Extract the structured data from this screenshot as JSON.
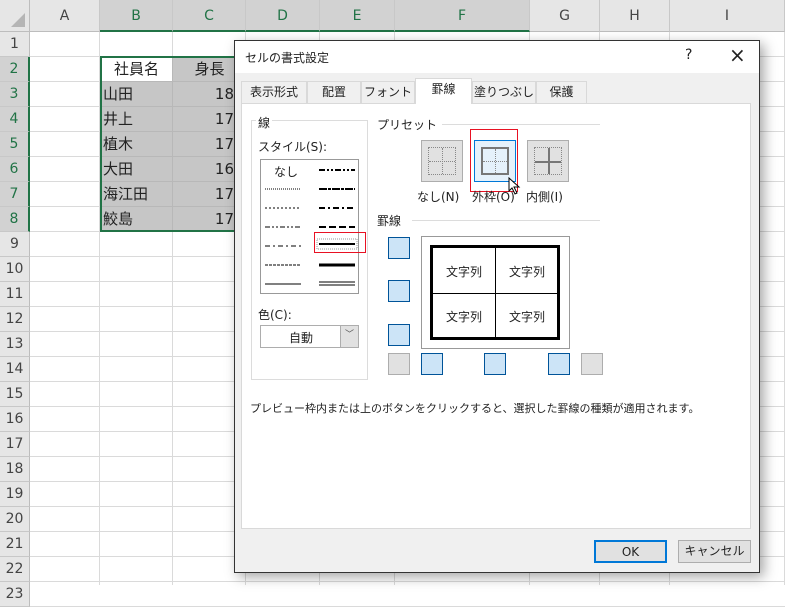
{
  "sheet": {
    "columns": [
      "A",
      "B",
      "C",
      "D",
      "E",
      "F",
      "G",
      "H",
      "I"
    ],
    "rows": [
      "1",
      "2",
      "3",
      "4",
      "5",
      "6",
      "7",
      "8",
      "9",
      "10",
      "11",
      "12",
      "13",
      "14",
      "15",
      "16",
      "17",
      "18",
      "19",
      "20",
      "21",
      "22",
      "23"
    ],
    "header_cells": {
      "b2": "社員名",
      "c2": "身長"
    },
    "names": [
      "山田",
      "井上",
      "植木",
      "大田",
      "海江田",
      "鮫島"
    ],
    "heights": [
      "18",
      "17",
      "17",
      "16",
      "17",
      "17"
    ]
  },
  "dialog": {
    "title": "セルの書式設定",
    "help": "?",
    "close": "×",
    "tabs": [
      "表示形式",
      "配置",
      "フォント",
      "罫線",
      "塗りつぶし",
      "保護"
    ],
    "active_tab": "罫線",
    "line_group": "線",
    "style_label": "スタイル(S):",
    "style_none": "なし",
    "color_label": "色(C):",
    "color_value": "自動",
    "preset_label": "プリセット",
    "presets": [
      "なし(N)",
      "外枠(O)",
      "内側(I)"
    ],
    "border_label": "罫線",
    "preview_text": "文字列",
    "hint": "プレビュー枠内または上のボタンをクリックすると、選択した罫線の種類が適用されます。",
    "ok": "OK",
    "cancel": "キャンセル"
  },
  "colors": {
    "accent": "#217346",
    "focus": "#0078d7",
    "highlight": "#e81123"
  }
}
